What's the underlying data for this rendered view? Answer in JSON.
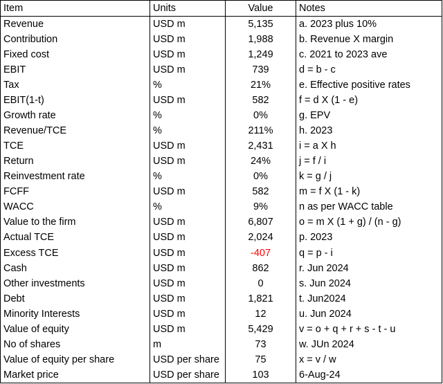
{
  "header": {
    "item": "Item",
    "units": "Units",
    "value": "Value",
    "notes": "Notes"
  },
  "rows": [
    {
      "item": "Revenue",
      "units": "USD m",
      "value": "5,135",
      "notes": "a. 2023 plus 10%"
    },
    {
      "item": "Contribution",
      "units": "USD m",
      "value": "1,988",
      "notes": "b. Revenue X margin"
    },
    {
      "item": "Fixed cost",
      "units": "USD m",
      "value": "1,249",
      "notes": "c. 2021 to 2023 ave"
    },
    {
      "item": "EBIT",
      "units": "USD m",
      "value": "739",
      "notes": "d = b - c"
    },
    {
      "item": "Tax",
      "units": "%",
      "value": "21%",
      "notes": "e. Effective positive rates"
    },
    {
      "item": "EBIT(1-t)",
      "units": "USD m",
      "value": "582",
      "notes": "f = d X (1 - e)"
    },
    {
      "item": "Growth rate",
      "units": "%",
      "value": "0%",
      "notes": "g. EPV"
    },
    {
      "item": "Revenue/TCE",
      "units": "%",
      "value": "211%",
      "notes": "h. 2023"
    },
    {
      "item": "TCE",
      "units": "USD m",
      "value": "2,431",
      "notes": "i = a X h"
    },
    {
      "item": "Return",
      "units": "USD m",
      "value": "24%",
      "notes": "j = f / i"
    },
    {
      "item": "Reinvestment rate",
      "units": "%",
      "value": "0%",
      "notes": "k = g / j"
    },
    {
      "item": "FCFF",
      "units": "USD m",
      "value": "582",
      "notes": "m = f X (1 - k)"
    },
    {
      "item": "WACC",
      "units": "%",
      "value": "9%",
      "notes": "n as per WACC table"
    },
    {
      "item": "Value to the firm",
      "units": "USD m",
      "value": "6,807",
      "notes": "o = m X (1 + g) / (n - g)"
    },
    {
      "item": "Actual TCE",
      "units": "USD m",
      "value": "2,024",
      "notes": "p. 2023"
    },
    {
      "item": "Excess TCE",
      "units": "USD m",
      "value": "-407",
      "notes": "q = p - i",
      "negative": true
    },
    {
      "item": "Cash",
      "units": "USD m",
      "value": "862",
      "notes": "r. Jun 2024"
    },
    {
      "item": "Other investments",
      "units": "USD m",
      "value": "0",
      "notes": "s. Jun 2024"
    },
    {
      "item": "Debt",
      "units": "USD m",
      "value": "1,821",
      "notes": "t. Jun2024"
    },
    {
      "item": "Minority Interests",
      "units": "USD m",
      "value": "12",
      "notes": "u. Jun 2024"
    },
    {
      "item": "Value of equity",
      "units": "USD m",
      "value": "5,429",
      "notes": "v = o + q + r + s - t - u"
    },
    {
      "item": "No of shares",
      "units": "m",
      "value": "73",
      "notes": "w. JUn 2024"
    },
    {
      "item": "Value of equity per share",
      "units": "USD per share",
      "value": "75",
      "notes": "x = v / w"
    },
    {
      "item": "Market price",
      "units": "USD per share",
      "value": "103",
      "notes": "6-Aug-24"
    }
  ],
  "colors": {
    "negative": "#ff0000",
    "text": "#000000"
  }
}
